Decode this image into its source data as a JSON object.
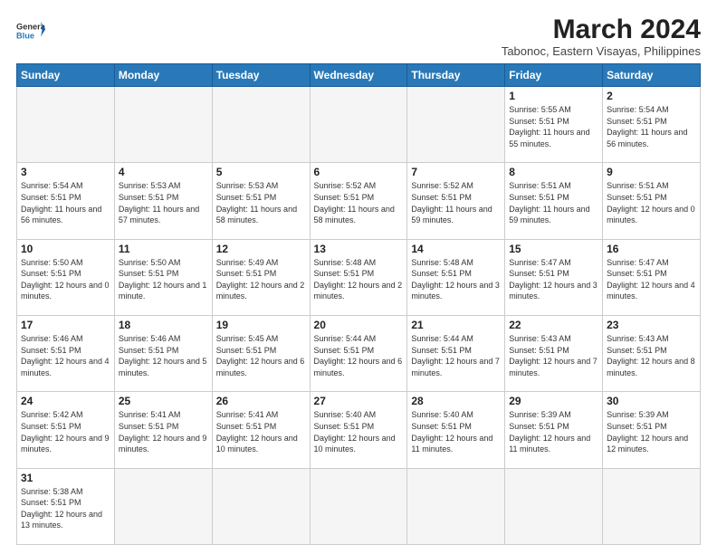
{
  "header": {
    "logo_general": "General",
    "logo_blue": "Blue",
    "title": "March 2024",
    "subtitle": "Tabonoc, Eastern Visayas, Philippines"
  },
  "days_of_week": [
    "Sunday",
    "Monday",
    "Tuesday",
    "Wednesday",
    "Thursday",
    "Friday",
    "Saturday"
  ],
  "weeks": [
    [
      {
        "day": "",
        "info": ""
      },
      {
        "day": "",
        "info": ""
      },
      {
        "day": "",
        "info": ""
      },
      {
        "day": "",
        "info": ""
      },
      {
        "day": "",
        "info": ""
      },
      {
        "day": "1",
        "info": "Sunrise: 5:55 AM\nSunset: 5:51 PM\nDaylight: 11 hours\nand 55 minutes."
      },
      {
        "day": "2",
        "info": "Sunrise: 5:54 AM\nSunset: 5:51 PM\nDaylight: 11 hours\nand 56 minutes."
      }
    ],
    [
      {
        "day": "3",
        "info": "Sunrise: 5:54 AM\nSunset: 5:51 PM\nDaylight: 11 hours\nand 56 minutes."
      },
      {
        "day": "4",
        "info": "Sunrise: 5:53 AM\nSunset: 5:51 PM\nDaylight: 11 hours\nand 57 minutes."
      },
      {
        "day": "5",
        "info": "Sunrise: 5:53 AM\nSunset: 5:51 PM\nDaylight: 11 hours\nand 58 minutes."
      },
      {
        "day": "6",
        "info": "Sunrise: 5:52 AM\nSunset: 5:51 PM\nDaylight: 11 hours\nand 58 minutes."
      },
      {
        "day": "7",
        "info": "Sunrise: 5:52 AM\nSunset: 5:51 PM\nDaylight: 11 hours\nand 59 minutes."
      },
      {
        "day": "8",
        "info": "Sunrise: 5:51 AM\nSunset: 5:51 PM\nDaylight: 11 hours\nand 59 minutes."
      },
      {
        "day": "9",
        "info": "Sunrise: 5:51 AM\nSunset: 5:51 PM\nDaylight: 12 hours\nand 0 minutes."
      }
    ],
    [
      {
        "day": "10",
        "info": "Sunrise: 5:50 AM\nSunset: 5:51 PM\nDaylight: 12 hours\nand 0 minutes."
      },
      {
        "day": "11",
        "info": "Sunrise: 5:50 AM\nSunset: 5:51 PM\nDaylight: 12 hours\nand 1 minute."
      },
      {
        "day": "12",
        "info": "Sunrise: 5:49 AM\nSunset: 5:51 PM\nDaylight: 12 hours\nand 2 minutes."
      },
      {
        "day": "13",
        "info": "Sunrise: 5:48 AM\nSunset: 5:51 PM\nDaylight: 12 hours\nand 2 minutes."
      },
      {
        "day": "14",
        "info": "Sunrise: 5:48 AM\nSunset: 5:51 PM\nDaylight: 12 hours\nand 3 minutes."
      },
      {
        "day": "15",
        "info": "Sunrise: 5:47 AM\nSunset: 5:51 PM\nDaylight: 12 hours\nand 3 minutes."
      },
      {
        "day": "16",
        "info": "Sunrise: 5:47 AM\nSunset: 5:51 PM\nDaylight: 12 hours\nand 4 minutes."
      }
    ],
    [
      {
        "day": "17",
        "info": "Sunrise: 5:46 AM\nSunset: 5:51 PM\nDaylight: 12 hours\nand 4 minutes."
      },
      {
        "day": "18",
        "info": "Sunrise: 5:46 AM\nSunset: 5:51 PM\nDaylight: 12 hours\nand 5 minutes."
      },
      {
        "day": "19",
        "info": "Sunrise: 5:45 AM\nSunset: 5:51 PM\nDaylight: 12 hours\nand 6 minutes."
      },
      {
        "day": "20",
        "info": "Sunrise: 5:44 AM\nSunset: 5:51 PM\nDaylight: 12 hours\nand 6 minutes."
      },
      {
        "day": "21",
        "info": "Sunrise: 5:44 AM\nSunset: 5:51 PM\nDaylight: 12 hours\nand 7 minutes."
      },
      {
        "day": "22",
        "info": "Sunrise: 5:43 AM\nSunset: 5:51 PM\nDaylight: 12 hours\nand 7 minutes."
      },
      {
        "day": "23",
        "info": "Sunrise: 5:43 AM\nSunset: 5:51 PM\nDaylight: 12 hours\nand 8 minutes."
      }
    ],
    [
      {
        "day": "24",
        "info": "Sunrise: 5:42 AM\nSunset: 5:51 PM\nDaylight: 12 hours\nand 9 minutes."
      },
      {
        "day": "25",
        "info": "Sunrise: 5:41 AM\nSunset: 5:51 PM\nDaylight: 12 hours\nand 9 minutes."
      },
      {
        "day": "26",
        "info": "Sunrise: 5:41 AM\nSunset: 5:51 PM\nDaylight: 12 hours\nand 10 minutes."
      },
      {
        "day": "27",
        "info": "Sunrise: 5:40 AM\nSunset: 5:51 PM\nDaylight: 12 hours\nand 10 minutes."
      },
      {
        "day": "28",
        "info": "Sunrise: 5:40 AM\nSunset: 5:51 PM\nDaylight: 12 hours\nand 11 minutes."
      },
      {
        "day": "29",
        "info": "Sunrise: 5:39 AM\nSunset: 5:51 PM\nDaylight: 12 hours\nand 11 minutes."
      },
      {
        "day": "30",
        "info": "Sunrise: 5:39 AM\nSunset: 5:51 PM\nDaylight: 12 hours\nand 12 minutes."
      }
    ],
    [
      {
        "day": "31",
        "info": "Sunrise: 5:38 AM\nSunset: 5:51 PM\nDaylight: 12 hours\nand 13 minutes."
      },
      {
        "day": "",
        "info": ""
      },
      {
        "day": "",
        "info": ""
      },
      {
        "day": "",
        "info": ""
      },
      {
        "day": "",
        "info": ""
      },
      {
        "day": "",
        "info": ""
      },
      {
        "day": "",
        "info": ""
      }
    ]
  ]
}
